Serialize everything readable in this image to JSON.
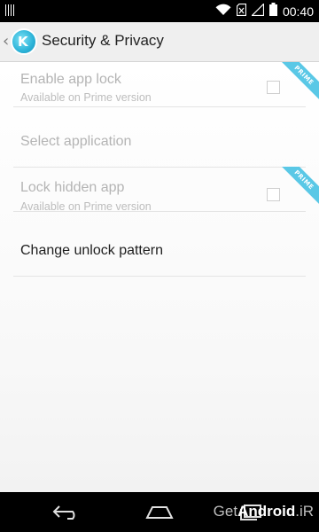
{
  "status_bar": {
    "time": "00:40"
  },
  "action_bar": {
    "title": "Security & Privacy",
    "up_icon": "chevron-left-icon",
    "logo_icon": "app-logo-icon",
    "logo_letter": "K"
  },
  "preferences": [
    {
      "title": "Enable app lock",
      "summary": "Available on Prime version",
      "enabled": false,
      "has_checkbox": true,
      "checked": false,
      "badge": "PRIME"
    },
    {
      "title": "Select application",
      "enabled": false
    },
    {
      "title": "Lock hidden app",
      "summary": "Available on Prime version",
      "enabled": false,
      "has_checkbox": true,
      "checked": false,
      "badge": "PRIME"
    },
    {
      "title": "Change unlock pattern",
      "enabled": true
    }
  ],
  "nav_bar": {
    "back_icon": "back-icon",
    "home_icon": "home-icon",
    "recents_icon": "recents-icon",
    "watermark_prefix": "Get",
    "watermark_brand": "Android",
    "watermark_suffix": ".iR"
  },
  "colors": {
    "accent": "#5ac8e6",
    "disabled_text": "#b4b4b4",
    "enabled_text": "#1e1e1e"
  }
}
